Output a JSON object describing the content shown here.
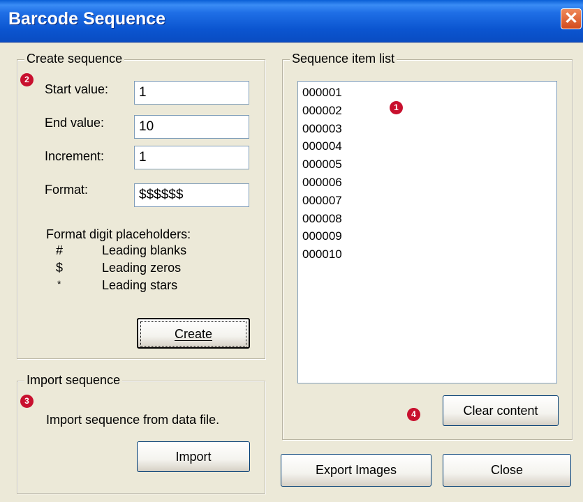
{
  "window": {
    "title": "Barcode Sequence",
    "close_symbol": "✕"
  },
  "create": {
    "group_title": "Create sequence",
    "start_label": "Start value:",
    "start_value": "1",
    "end_label": "End value:",
    "end_value": "10",
    "increment_label": "Increment:",
    "increment_value": "1",
    "format_label": "Format:",
    "format_value": "$$$$$$",
    "placeholders_title": "Format digit placeholders:",
    "placeholders": [
      {
        "symbol": "#",
        "desc": "Leading blanks"
      },
      {
        "symbol": "$",
        "desc": "Leading zeros"
      },
      {
        "symbol": "*",
        "desc": "Leading stars"
      }
    ],
    "create_button": "Create"
  },
  "import": {
    "group_title": "Import sequence",
    "description": "Import sequence from data file.",
    "import_button": "Import"
  },
  "list": {
    "group_title": "Sequence item list",
    "items": [
      "000001",
      "000002",
      "000003",
      "000004",
      "000005",
      "000006",
      "000007",
      "000008",
      "000009",
      "000010"
    ],
    "clear_button": "Clear content"
  },
  "footer": {
    "export_button": "Export Images",
    "close_button": "Close"
  },
  "badges": {
    "b1": "1",
    "b2": "2",
    "b3": "3",
    "b4": "4"
  }
}
